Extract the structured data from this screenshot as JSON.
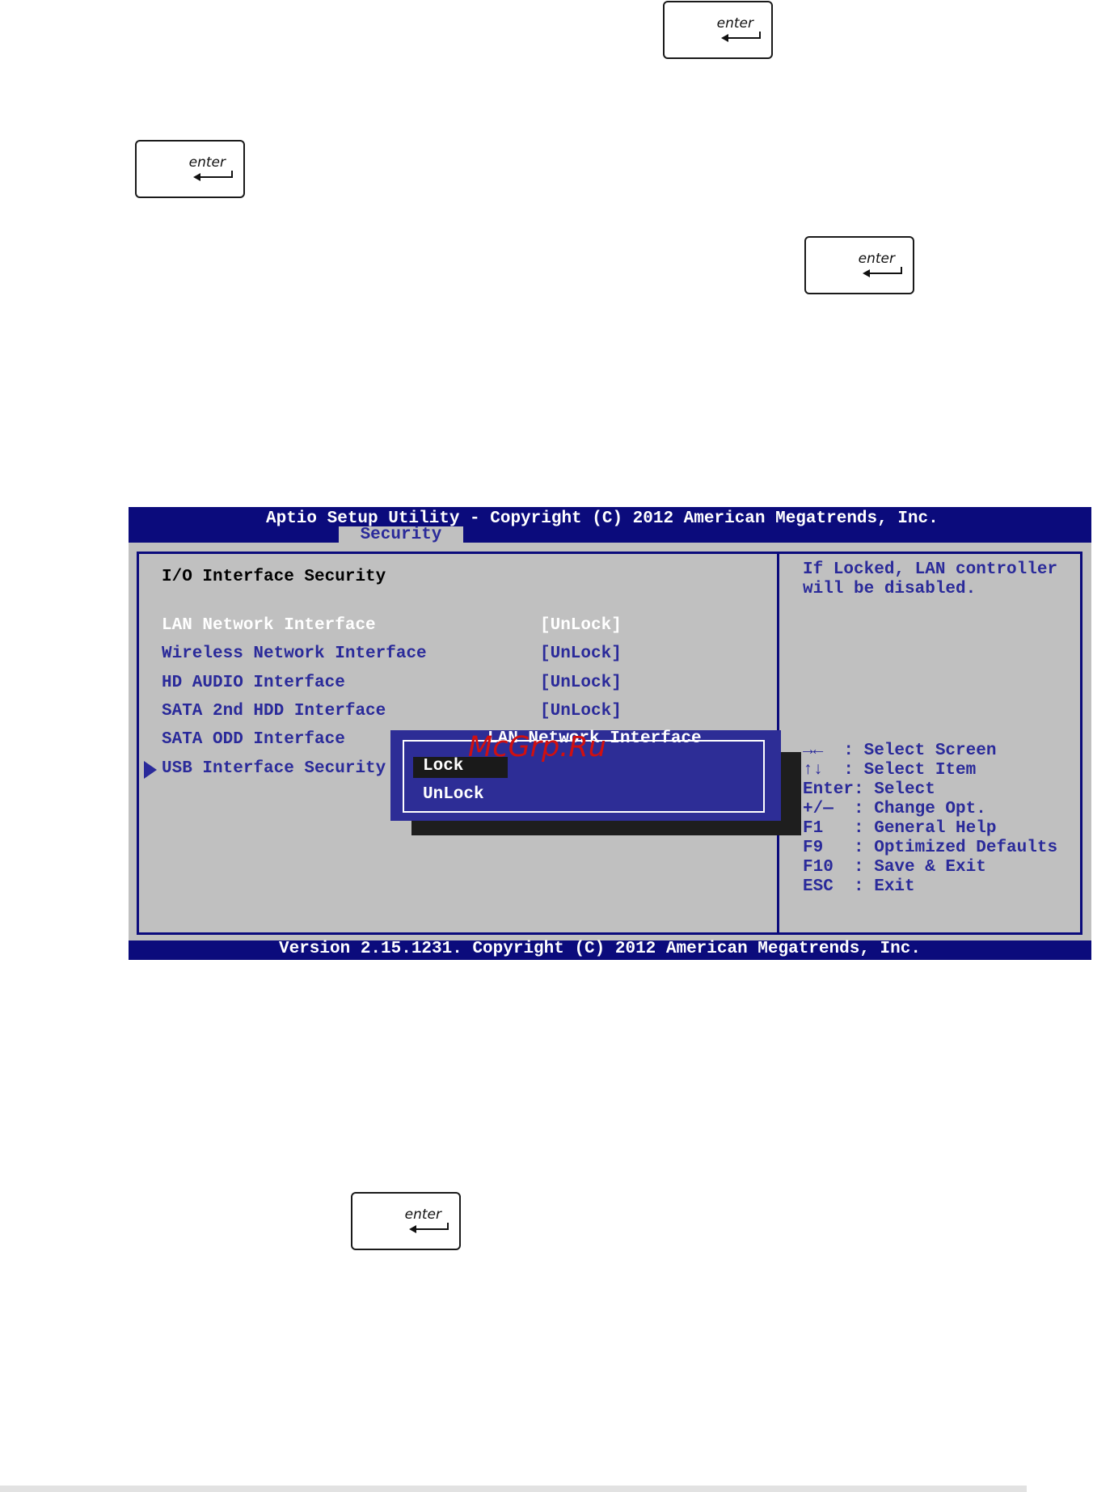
{
  "enter_key_label": "enter",
  "bios": {
    "title": "Aptio Setup Utility - Copyright (C) 2012 American Megatrends, Inc.",
    "active_tab": "Security",
    "section_heading": "I/O Interface Security",
    "items": [
      {
        "label": "LAN Network Interface",
        "value": "[UnLock]"
      },
      {
        "label": "Wireless Network Interface",
        "value": "[UnLock]"
      },
      {
        "label": "HD AUDIO Interface",
        "value": "[UnLock]"
      },
      {
        "label": "SATA 2nd HDD Interface",
        "value": "[UnLock]"
      },
      {
        "label": "SATA ODD Interface",
        "value": ""
      },
      {
        "label": "USB Interface Security",
        "value": ""
      }
    ],
    "help_text": [
      "If Locked, LAN controller",
      "will be disabled."
    ],
    "key_help": [
      "→←  : Select Screen",
      "↑↓  : Select Item",
      "Enter: Select",
      "+/—  : Change Opt.",
      "F1   : General Help",
      "F9   : Optimized Defaults",
      "F10  : Save & Exit",
      "ESC  : Exit"
    ],
    "popup": {
      "title": "LAN Network Interface",
      "options": [
        "Lock",
        "UnLock"
      ]
    },
    "version": "Version 2.15.1231. Copyright (C) 2012 American Megatrends, Inc."
  },
  "watermark": "McGrp.Ru"
}
